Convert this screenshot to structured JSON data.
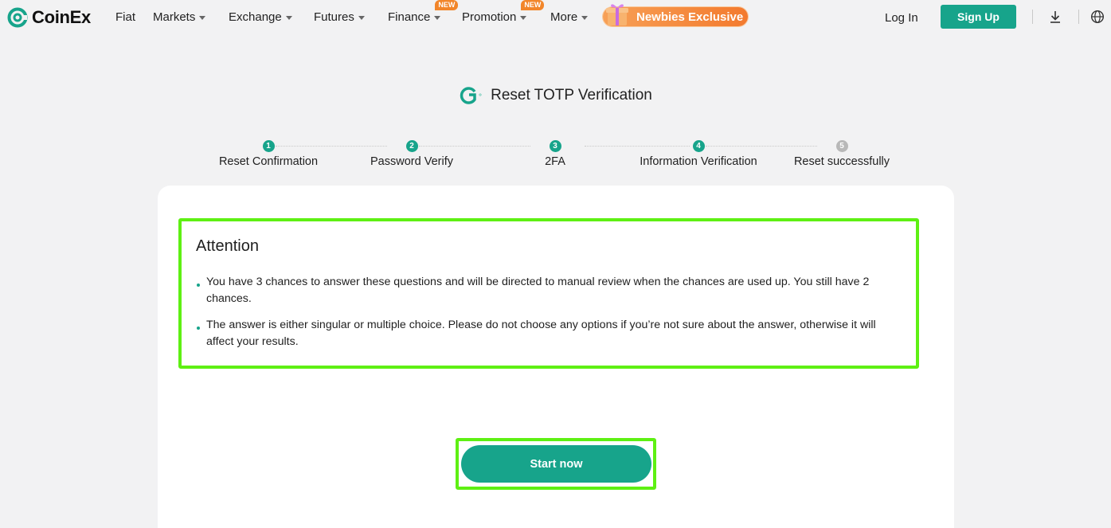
{
  "header": {
    "brand": "CoinEx",
    "nav": [
      {
        "label": "Fiat",
        "caret": false,
        "badge": ""
      },
      {
        "label": "Markets",
        "caret": true,
        "badge": ""
      },
      {
        "label": "Exchange",
        "caret": true,
        "badge": ""
      },
      {
        "label": "Futures",
        "caret": true,
        "badge": ""
      },
      {
        "label": "Finance",
        "caret": true,
        "badge": "NEW"
      },
      {
        "label": "Promotion",
        "caret": true,
        "badge": "NEW"
      },
      {
        "label": "More",
        "caret": true,
        "badge": ""
      }
    ],
    "newbies_label": "Newbies Exclusive",
    "login_label": "Log In",
    "signup_label": "Sign Up",
    "icons": [
      "download-icon",
      "globe-icon"
    ]
  },
  "page": {
    "title": "Reset TOTP Verification",
    "steps": [
      {
        "number": "1",
        "label": "Reset Confirmation",
        "done": true
      },
      {
        "number": "2",
        "label": "Password Verify",
        "done": true
      },
      {
        "number": "3",
        "label": "2FA",
        "done": true
      },
      {
        "number": "4",
        "label": "Information Verification",
        "done": true
      },
      {
        "number": "5",
        "label": "Reset successfully",
        "done": false
      }
    ]
  },
  "attention": {
    "title": "Attention",
    "bullets": [
      "You have 3 chances to answer these questions and will be directed to manual review when the chances are used up. You still have 2 chances.",
      "The answer is either singular or multiple choice. Please do not choose any options if you’re not sure about the answer, otherwise it will affect your results."
    ]
  },
  "actions": {
    "start_label": "Start now"
  },
  "colors": {
    "brand": "#17a48b",
    "highlight": "#5ef013",
    "badge": "#f2862a"
  }
}
